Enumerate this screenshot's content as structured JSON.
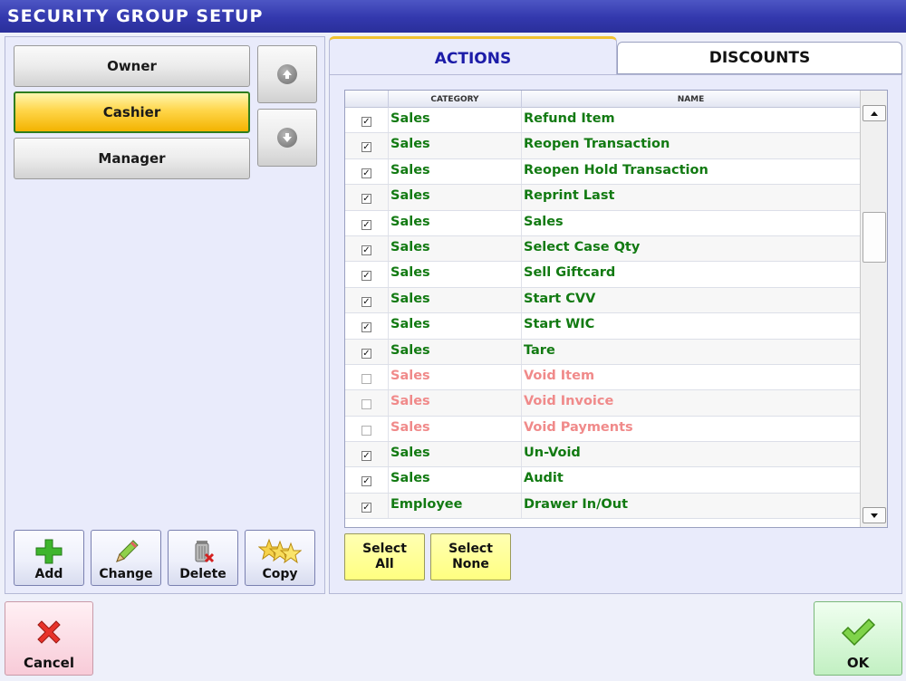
{
  "window": {
    "title": "SECURITY GROUP SETUP"
  },
  "groups": [
    {
      "label": "Owner",
      "selected": false
    },
    {
      "label": "Cashier",
      "selected": true
    },
    {
      "label": "Manager",
      "selected": false
    }
  ],
  "toolbar": {
    "add_label": "Add",
    "change_label": "Change",
    "delete_label": "Delete",
    "copy_label": "Copy"
  },
  "tabs": {
    "actions_label": "ACTIONS",
    "discounts_label": "DISCOUNTS",
    "active": "ACTIONS"
  },
  "grid": {
    "columns": {
      "category": "CATEGORY",
      "name": "NAME"
    },
    "rows": [
      {
        "checked": true,
        "category": "Sales",
        "name": "Refund Item"
      },
      {
        "checked": true,
        "category": "Sales",
        "name": "Reopen Transaction"
      },
      {
        "checked": true,
        "category": "Sales",
        "name": "Reopen Hold Transaction"
      },
      {
        "checked": true,
        "category": "Sales",
        "name": "Reprint Last"
      },
      {
        "checked": true,
        "category": "Sales",
        "name": "Sales"
      },
      {
        "checked": true,
        "category": "Sales",
        "name": "Select Case Qty"
      },
      {
        "checked": true,
        "category": "Sales",
        "name": "Sell Giftcard"
      },
      {
        "checked": true,
        "category": "Sales",
        "name": "Start CVV"
      },
      {
        "checked": true,
        "category": "Sales",
        "name": "Start WIC"
      },
      {
        "checked": true,
        "category": "Sales",
        "name": "Tare"
      },
      {
        "checked": false,
        "category": "Sales",
        "name": "Void Item"
      },
      {
        "checked": false,
        "category": "Sales",
        "name": "Void Invoice"
      },
      {
        "checked": false,
        "category": "Sales",
        "name": "Void Payments"
      },
      {
        "checked": true,
        "category": "Sales",
        "name": "Un-Void"
      },
      {
        "checked": true,
        "category": "Sales",
        "name": "Audit"
      },
      {
        "checked": true,
        "category": "Employee",
        "name": "Drawer In/Out"
      }
    ]
  },
  "selection": {
    "select_all_line1": "Select",
    "select_all_line2": "All",
    "select_none_line1": "Select",
    "select_none_line2": "None"
  },
  "footer": {
    "cancel_label": "Cancel",
    "ok_label": "OK"
  },
  "colors": {
    "title_bar": "#3338ad",
    "enabled_text": "#127a12",
    "disabled_text": "#f08a8a",
    "selected_group": "#ffd64a",
    "active_tab_text": "#1c1ca8"
  }
}
